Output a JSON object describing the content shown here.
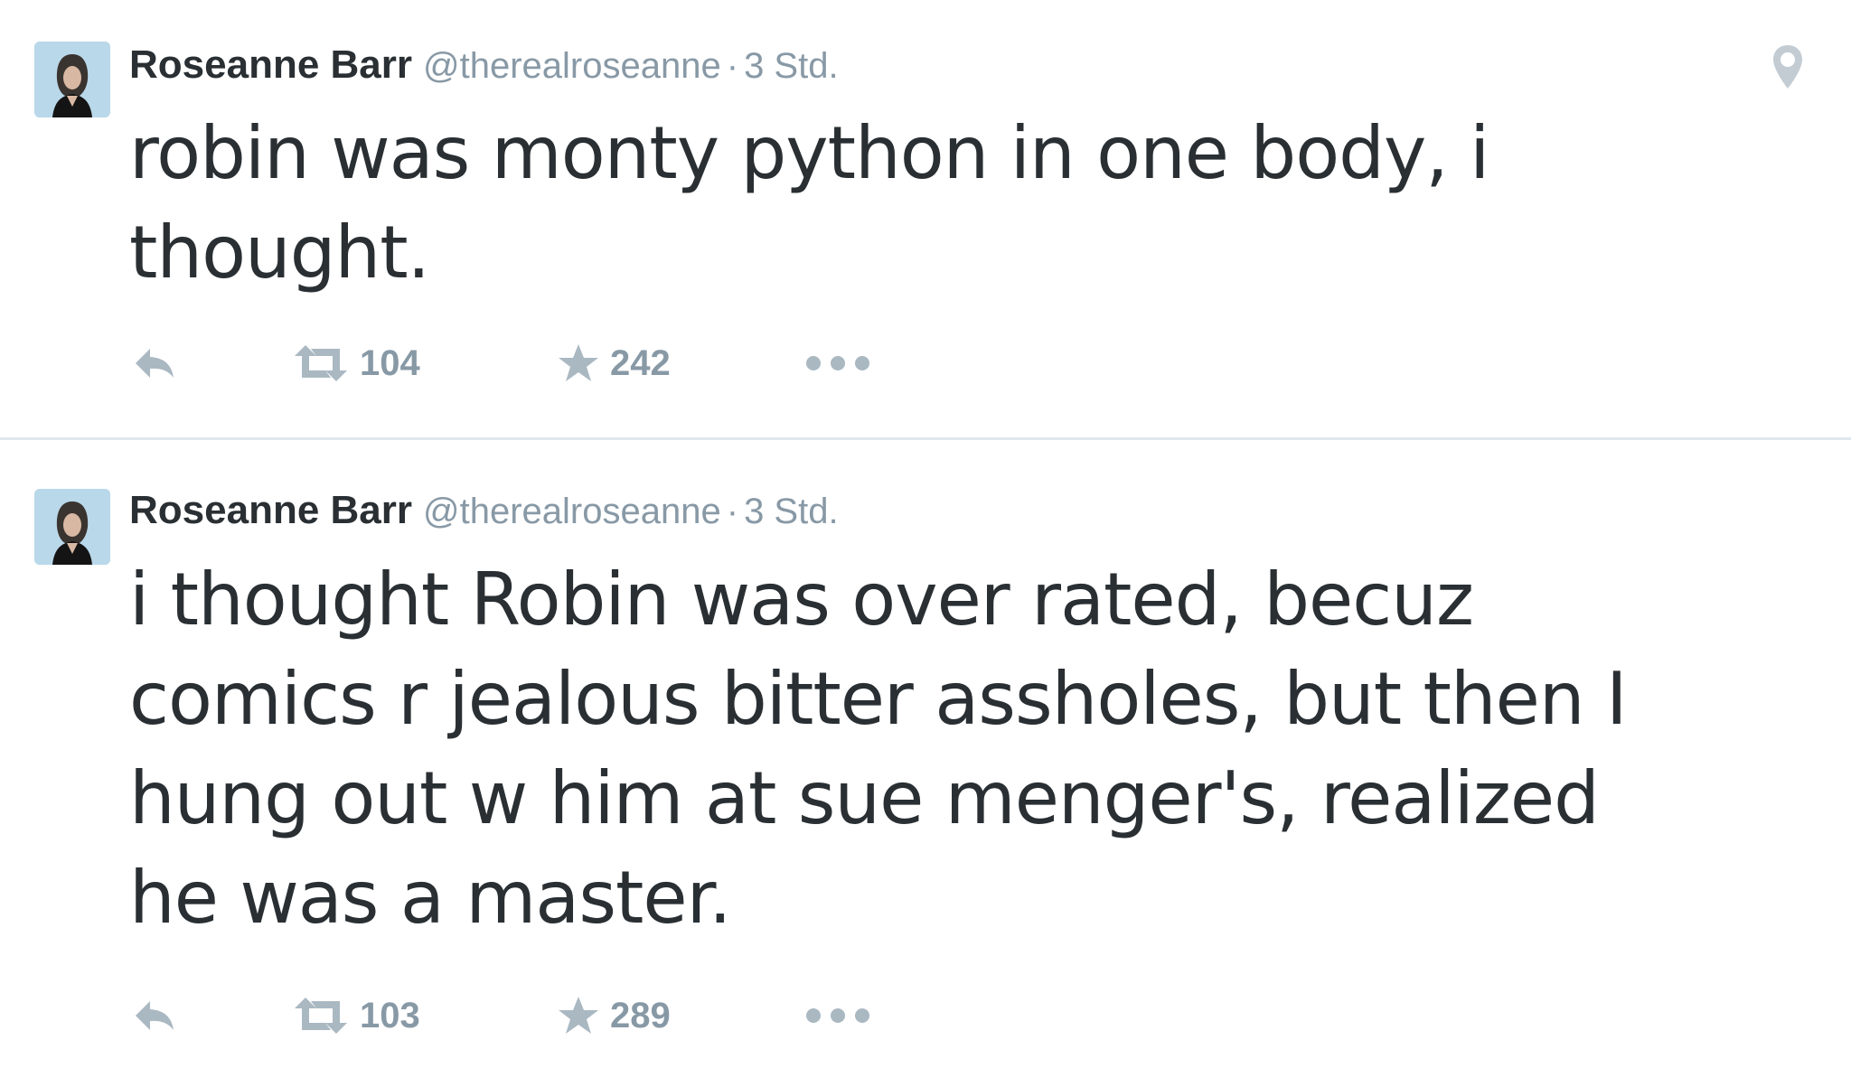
{
  "tweets": [
    {
      "author": {
        "fullname": "Roseanne Barr",
        "username": "@therealroseanne"
      },
      "separator": "·",
      "time": "3 Std.",
      "text_lines": [
        "robin was monty python in one body, i",
        "thought."
      ],
      "show_geo": true,
      "icons": {
        "avatar": "avatar",
        "reply": "reply-icon",
        "retweet": "retweet-icon",
        "favorite": "star-icon",
        "more": "more-dots-icon",
        "geo": "location-pin-icon"
      },
      "retweets": "104",
      "favorites": "242"
    },
    {
      "author": {
        "fullname": "Roseanne Barr",
        "username": "@therealroseanne"
      },
      "separator": "·",
      "time": "3 Std.",
      "text_lines": [
        "i thought Robin was over rated, becuz",
        "comics r jealous bitter assholes, but then I",
        "hung out w him at sue menger's, realized",
        "he was a master."
      ],
      "show_geo": false,
      "icons": {
        "avatar": "avatar",
        "reply": "reply-icon",
        "retweet": "retweet-icon",
        "favorite": "star-icon",
        "more": "more-dots-icon"
      },
      "retweets": "103",
      "favorites": "289"
    }
  ],
  "colors": {
    "text": "#292f33",
    "secondary": "#8899a6",
    "icon": "#aab8c2",
    "divider": "#e1e8ed"
  }
}
